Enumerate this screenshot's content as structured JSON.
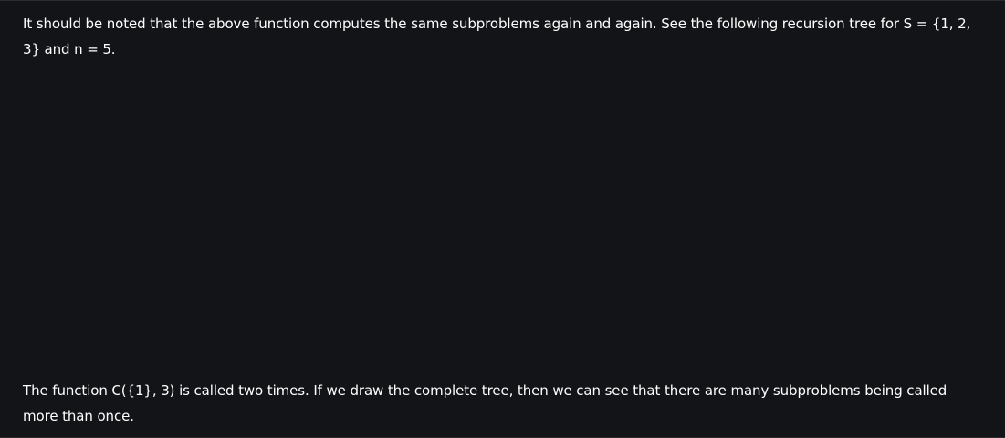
{
  "article": {
    "paragraph_1": "It should be noted that the above function computes the same subproblems again and again. See the following recursion tree for S = {1, 2, 3} and n = 5.",
    "paragraph_2": "The function C({1}, 3) is called two times. If we draw the complete tree, then we can see that there are many subproblems being called more than once."
  },
  "colors": {
    "background": "#131417",
    "text": "#ffffff"
  }
}
